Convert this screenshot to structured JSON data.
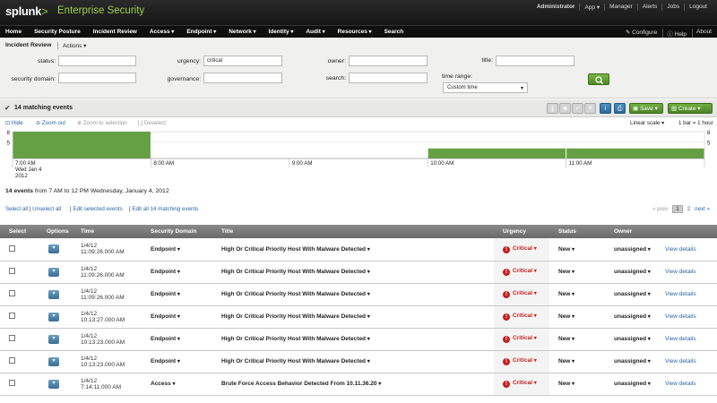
{
  "header": {
    "logo_text": "splunk",
    "logo_gt": ">",
    "app_name": "Enterprise Security",
    "user_links": [
      "Administrator",
      "App ▾",
      "Manager",
      "Alerts",
      "Jobs",
      "Logout"
    ]
  },
  "nav": {
    "items": [
      {
        "label": "Home",
        "dropdown": false
      },
      {
        "label": "Security Posture",
        "dropdown": false
      },
      {
        "label": "Incident Review",
        "dropdown": false
      },
      {
        "label": "Access",
        "dropdown": true
      },
      {
        "label": "Endpoint",
        "dropdown": true
      },
      {
        "label": "Network",
        "dropdown": true
      },
      {
        "label": "Identity",
        "dropdown": true
      },
      {
        "label": "Audit",
        "dropdown": true
      },
      {
        "label": "Resources",
        "dropdown": true
      },
      {
        "label": "Search",
        "dropdown": false
      }
    ],
    "right": [
      "Configure",
      "Help",
      "About"
    ]
  },
  "panel": {
    "title": "Incident Review",
    "actions_label": "Actions",
    "fields": {
      "status": {
        "label": "status:",
        "value": ""
      },
      "urgency": {
        "label": "urgency:",
        "value": "critical"
      },
      "owner": {
        "label": "owner:",
        "value": ""
      },
      "title": {
        "label": "title:",
        "value": ""
      },
      "security_domain": {
        "label": "security domain:",
        "value": ""
      },
      "governance": {
        "label": "governance:",
        "value": ""
      },
      "search": {
        "label": "search:",
        "value": ""
      },
      "time_range": {
        "label": "time range:",
        "value": "Custom time"
      }
    }
  },
  "matching": {
    "count_label": "14 matching events",
    "save_label": "Save",
    "create_label": "Create"
  },
  "timeline": {
    "hide_label": "Hide",
    "zoom_out_label": "Zoom out",
    "zoom_selection_label": "Zoom to selection",
    "deselect_label": "Deselect",
    "scale_label": "Linear scale",
    "bar_label": "1 bar = 1 hour",
    "y_ticks": [
      "8",
      "5"
    ],
    "x_ticks": [
      {
        "line1": "7:00 AM",
        "line2": "Wed Jan 4",
        "line3": "2012"
      },
      {
        "line1": "8:00 AM"
      },
      {
        "line1": "9:00 AM"
      },
      {
        "line1": "10:00 AM"
      },
      {
        "line1": "11:00 AM"
      }
    ]
  },
  "chart_data": {
    "type": "bar",
    "categories": [
      "7:00 AM",
      "8:00 AM",
      "9:00 AM",
      "10:00 AM",
      "11:00 AM"
    ],
    "values": [
      8,
      0,
      0,
      3,
      3
    ],
    "ylim": [
      0,
      8
    ],
    "color": "#65a044"
  },
  "events": {
    "summary_bold": "14 events",
    "summary_rest": "from 7 AM to 12 PM Wednesday, January 4, 2012",
    "select_all": "Select all",
    "unselect_all": "Unselect all",
    "edit_selected": "Edit selected events",
    "edit_all": "Edit all 14 matching events",
    "pager": {
      "prev": "« prev",
      "pages": [
        "1",
        "2"
      ],
      "next": "next »"
    },
    "columns": [
      "Select",
      "Options",
      "Time",
      "Security Domain",
      "Title",
      "Urgency",
      "Status",
      "Owner",
      ""
    ],
    "rows": [
      {
        "date": "1/4/12",
        "time": "11:09:26.000 AM",
        "domain": "Endpoint",
        "title": "High Or Critical Priority Host With Malware Detected",
        "urgency": "Critical",
        "status": "New",
        "owner": "unassigned",
        "details": "View details"
      },
      {
        "date": "1/4/12",
        "time": "11:09:26.000 AM",
        "domain": "Endpoint",
        "title": "High Or Critical Priority Host With Malware Detected",
        "urgency": "Critical",
        "status": "New",
        "owner": "unassigned",
        "details": "View details"
      },
      {
        "date": "1/4/12",
        "time": "11:09:26.000 AM",
        "domain": "Endpoint",
        "title": "High Or Critical Priority Host With Malware Detected",
        "urgency": "Critical",
        "status": "New",
        "owner": "unassigned",
        "details": "View details"
      },
      {
        "date": "1/4/12",
        "time": "10:13:27.000 AM",
        "domain": "Endpoint",
        "title": "High Or Critical Priority Host With Malware Detected",
        "urgency": "Critical",
        "status": "New",
        "owner": "unassigned",
        "details": "View details"
      },
      {
        "date": "1/4/12",
        "time": "10:13:23.000 AM",
        "domain": "Endpoint",
        "title": "High Or Critical Priority Host With Malware Detected",
        "urgency": "Critical",
        "status": "New",
        "owner": "unassigned",
        "details": "View details"
      },
      {
        "date": "1/4/12",
        "time": "10:13:23.000 AM",
        "domain": "Endpoint",
        "title": "High Or Critical Priority Host With Malware Detected",
        "urgency": "Critical",
        "status": "New",
        "owner": "unassigned",
        "details": "View details"
      },
      {
        "date": "1/4/12",
        "time": "7:14:11.000 AM",
        "domain": "Access",
        "title": "Brute Force Access Behavior Detected From 10.11.36.20",
        "urgency": "Critical",
        "status": "New",
        "owner": "unassigned",
        "details": "View details"
      }
    ]
  },
  "colors": {
    "accent_green": "#65a044",
    "critical_red": "#c3211f",
    "link_blue": "#2b63a3"
  }
}
